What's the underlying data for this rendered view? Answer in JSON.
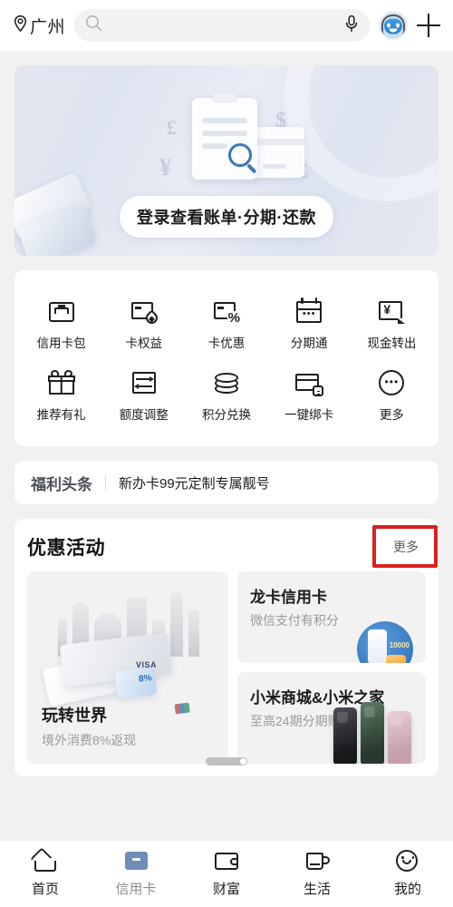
{
  "topbar": {
    "location_icon": "location-pin-icon",
    "location": "广州",
    "search_icon": "search-icon",
    "search_placeholder": "",
    "search_value": "",
    "mic_icon": "microphone-icon",
    "avatar_icon": "assistant-avatar-icon",
    "plus_icon": "plus-icon"
  },
  "banner": {
    "button_label": "登录查看账单·分期·还款",
    "currency_symbols": [
      "£",
      "¥",
      "$",
      "€"
    ],
    "illustration": "clipboard-search-card-illustration"
  },
  "quick_grid": {
    "items": [
      {
        "label": "信用卡包",
        "icon": "card-wallet-icon"
      },
      {
        "label": "卡权益",
        "icon": "card-benefit-icon"
      },
      {
        "label": "卡优惠",
        "icon": "card-discount-icon"
      },
      {
        "label": "分期通",
        "icon": "installment-calendar-icon"
      },
      {
        "label": "现金转出",
        "icon": "cash-transfer-out-icon"
      },
      {
        "label": "推荐有礼",
        "icon": "gift-referral-icon"
      },
      {
        "label": "额度调整",
        "icon": "credit-limit-adjust-icon"
      },
      {
        "label": "积分兑换",
        "icon": "points-exchange-icon"
      },
      {
        "label": "一键绑卡",
        "icon": "one-click-bind-card-icon"
      },
      {
        "label": "更多",
        "icon": "more-dots-icon"
      }
    ]
  },
  "news": {
    "badge": "福利头条",
    "headline": "新办卡99元定制专属靓号"
  },
  "promotions": {
    "title": "优惠活动",
    "more_label": "更多",
    "highlight_color": "#d8201f",
    "cards": [
      {
        "title": "玩转世界",
        "subtitle": "境外消费8%返现",
        "illustration": "world-landmarks-cards-illustration",
        "badge_text": "8%",
        "brand_visa": "VISA"
      },
      {
        "title": "龙卡信用卡",
        "subtitle": "微信支付有积分",
        "illustration": "phone-points-circle-illustration",
        "badge_text": "10000"
      },
      {
        "title": "小米商城&小米之家",
        "subtitle": "至高24期分期购",
        "illustration": "three-phones-illustration"
      }
    ],
    "scroll_indicator": "horizontal-scroll-indicator"
  },
  "tabbar": {
    "items": [
      {
        "label": "首页",
        "icon": "home-icon",
        "active": false
      },
      {
        "label": "信用卡",
        "icon": "credit-card-icon",
        "active": true
      },
      {
        "label": "财富",
        "icon": "wealth-wallet-icon",
        "active": false
      },
      {
        "label": "生活",
        "icon": "life-cup-icon",
        "active": false
      },
      {
        "label": "我的",
        "icon": "profile-smiley-icon",
        "active": false
      }
    ],
    "active_color": "#6f8cb6"
  }
}
